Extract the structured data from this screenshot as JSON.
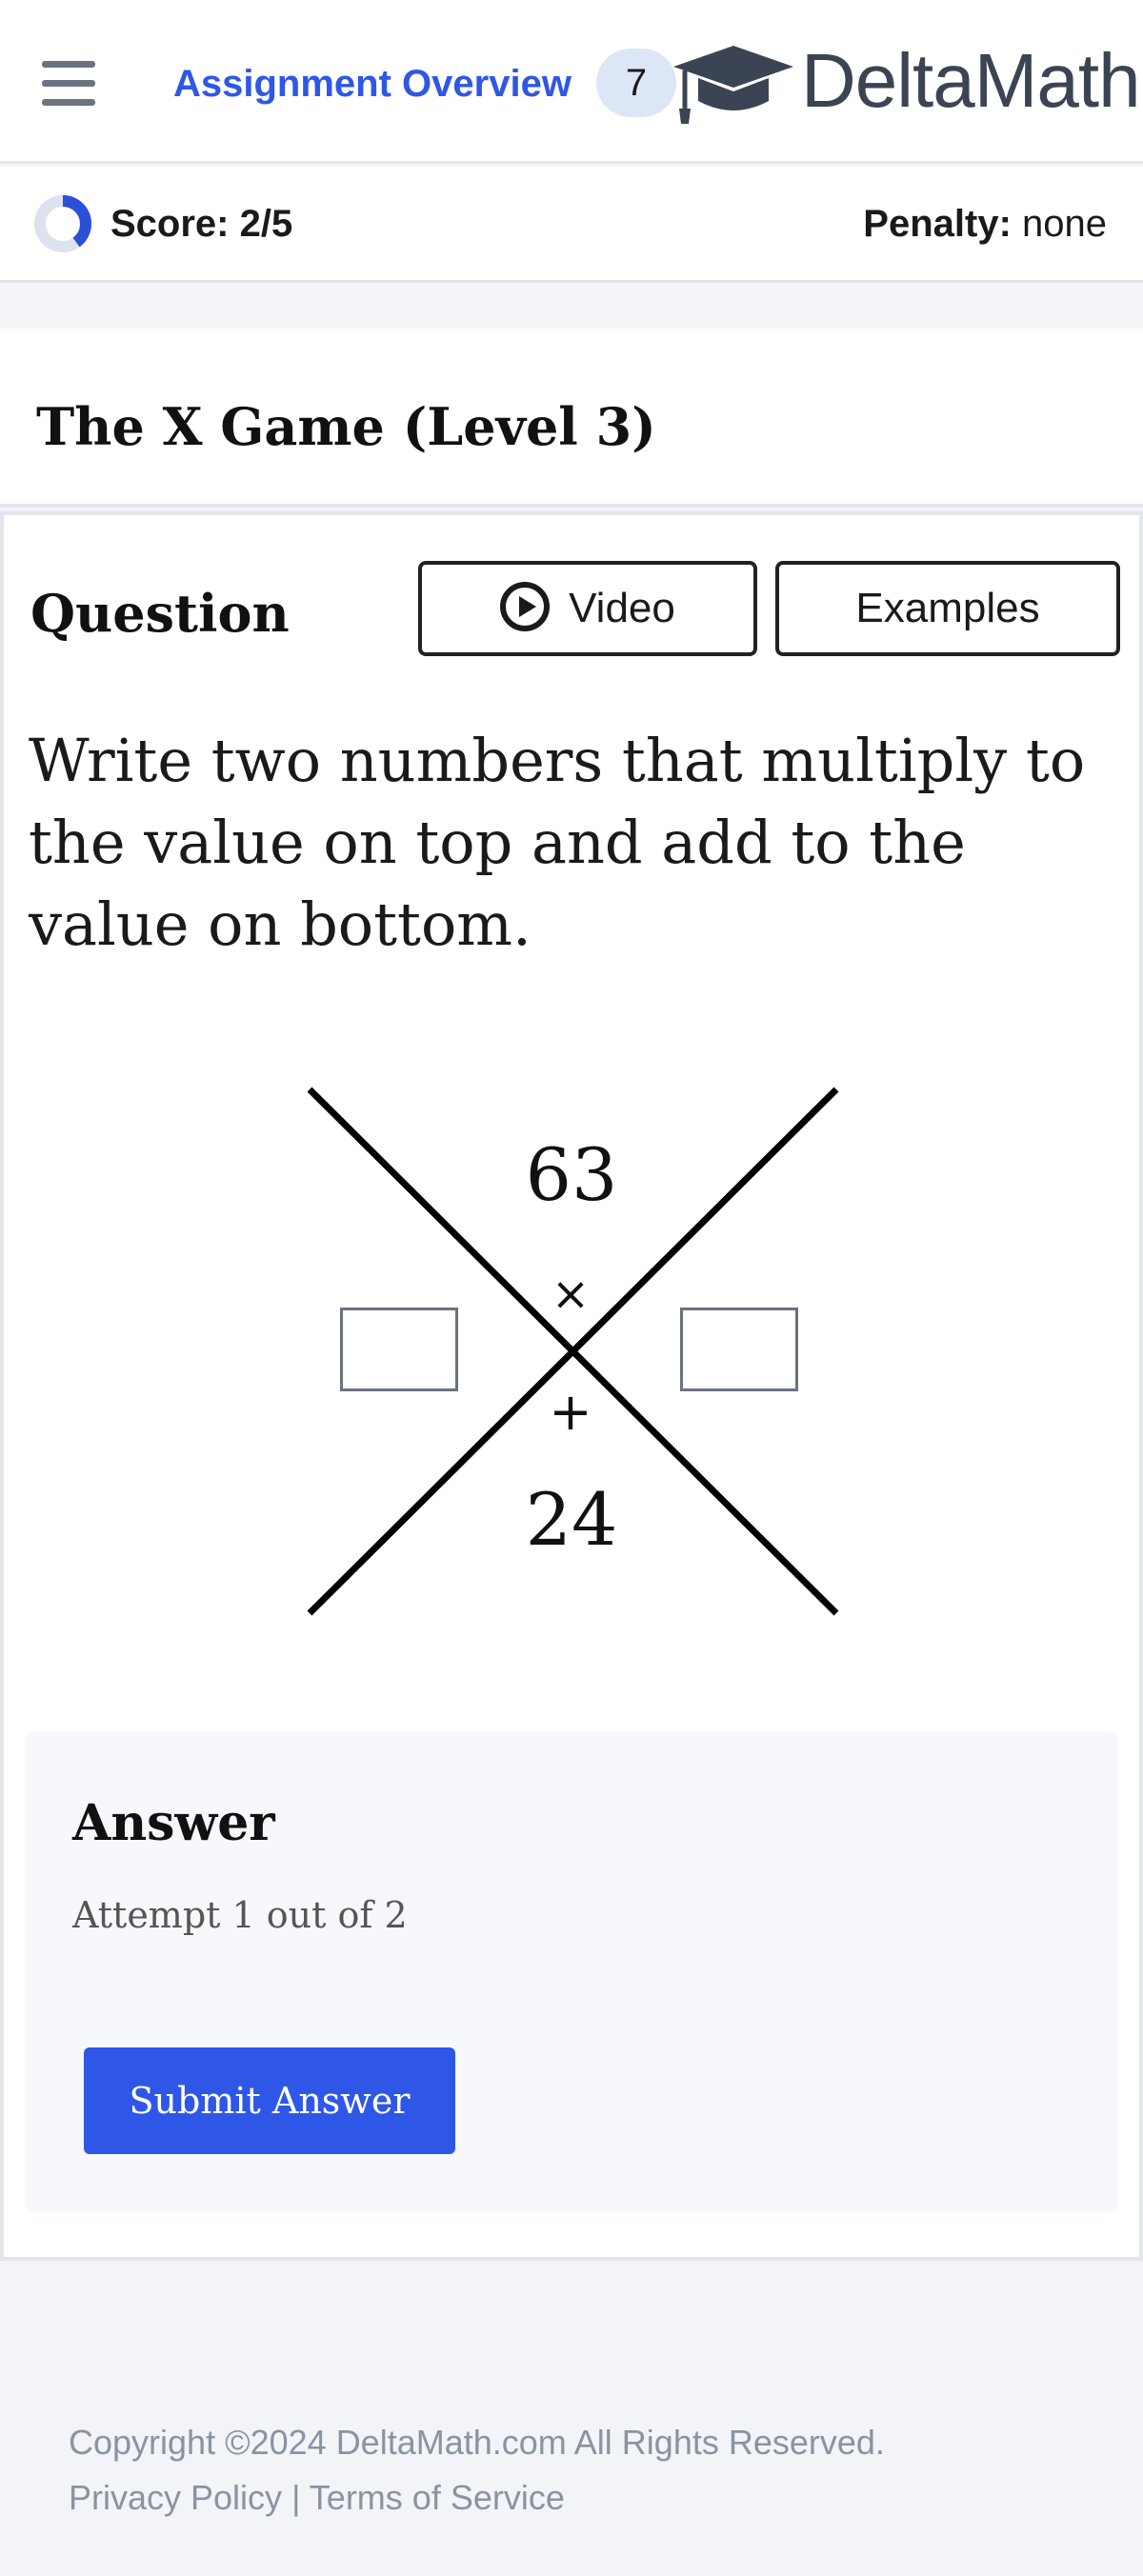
{
  "header": {
    "menu_icon": "hamburger-menu-icon",
    "assignment_link": "Assignment Overview",
    "count_badge": "7",
    "logo_text": "DeltaMath",
    "logo_icon": "graduation-cap-icon",
    "link_color": "#2f57e7"
  },
  "score": {
    "label": "Score: 2/5",
    "progress_fraction": 0.4,
    "penalty_label": "Penalty:",
    "penalty_value": "none"
  },
  "problem": {
    "title": "The X Game (Level 3)"
  },
  "question": {
    "label": "Question",
    "video_button": "Video",
    "examples_button": "Examples",
    "prompt": "Write two numbers that multiply to the value on top and add to the value on bottom.",
    "x_top": "63",
    "x_bottom": "24",
    "times_symbol": "×",
    "plus_symbol": "+"
  },
  "answer": {
    "label": "Answer",
    "attempt": "Attempt 1 out of 2",
    "submit": "Submit Answer",
    "submit_color": "#2f57e7"
  },
  "footer": {
    "copyright": "Copyright ©2024 DeltaMath.com All Rights Reserved.",
    "privacy": "Privacy Policy",
    "separator": "|",
    "terms": "Terms of Service"
  }
}
